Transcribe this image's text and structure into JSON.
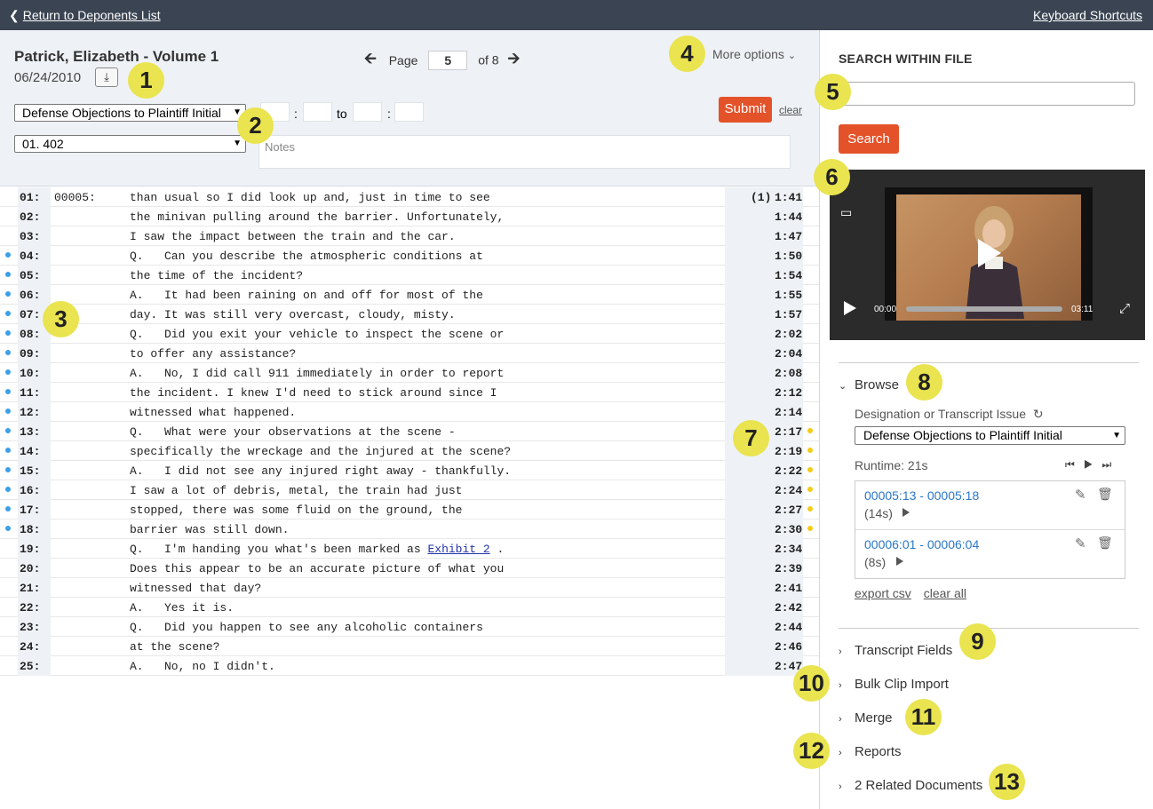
{
  "topbar": {
    "back_label": "Return to Deponents List",
    "shortcuts_label": "Keyboard Shortcuts"
  },
  "header": {
    "title": "Patrick, Elizabeth - Volume 1",
    "date": "06/24/2010",
    "page_label": "Page",
    "page_value": "5",
    "page_of": "of 8",
    "more_options": "More options",
    "designation_select": "Defense Objections to Plaintiff Initial",
    "issue_select": "01. 402",
    "to_label": "to",
    "colon": ":",
    "submit_label": "Submit",
    "clear_label": "clear",
    "notes_placeholder": "Notes"
  },
  "transcript": {
    "lines": [
      {
        "ln": "01:",
        "page": "00005:",
        "text": "than usual so I did look up and, just in time to see",
        "mark": "(1)",
        "ts": "1:41",
        "blue": false,
        "yellow": false
      },
      {
        "ln": "02:",
        "page": "",
        "text": "the minivan pulling around the barrier. Unfortunately,",
        "mark": "",
        "ts": "1:44",
        "blue": false,
        "yellow": false
      },
      {
        "ln": "03:",
        "page": "",
        "text": "I saw the impact between the train and the car.",
        "mark": "",
        "ts": "1:47",
        "blue": false,
        "yellow": false
      },
      {
        "ln": "04:",
        "page": "",
        "text": "Q.   Can you describe the atmospheric conditions at",
        "mark": "",
        "ts": "1:50",
        "blue": true,
        "yellow": false
      },
      {
        "ln": "05:",
        "page": "",
        "text": "the time of the incident?",
        "mark": "",
        "ts": "1:54",
        "blue": true,
        "yellow": false
      },
      {
        "ln": "06:",
        "page": "",
        "text": "A.   It had been raining on and off for most of the",
        "mark": "",
        "ts": "1:55",
        "blue": true,
        "yellow": false
      },
      {
        "ln": "07:",
        "page": "",
        "text": "day. It was still very overcast, cloudy, misty.",
        "mark": "",
        "ts": "1:57",
        "blue": true,
        "yellow": false
      },
      {
        "ln": "08:",
        "page": "",
        "text": "Q.   Did you exit your vehicle to inspect the scene or",
        "mark": "",
        "ts": "2:02",
        "blue": true,
        "yellow": false
      },
      {
        "ln": "09:",
        "page": "",
        "text": "to offer any assistance?",
        "mark": "",
        "ts": "2:04",
        "blue": true,
        "yellow": false
      },
      {
        "ln": "10:",
        "page": "",
        "text": "A.   No, I did call 911 immediately in order to report",
        "mark": "",
        "ts": "2:08",
        "blue": true,
        "yellow": false
      },
      {
        "ln": "11:",
        "page": "",
        "text": "the incident. I knew I'd need to stick around since I",
        "mark": "",
        "ts": "2:12",
        "blue": true,
        "yellow": false
      },
      {
        "ln": "12:",
        "page": "",
        "text": "witnessed what happened.",
        "mark": "",
        "ts": "2:14",
        "blue": true,
        "yellow": false
      },
      {
        "ln": "13:",
        "page": "",
        "text": "Q.   What were your observations at the scene -",
        "mark": "",
        "ts": "2:17",
        "blue": true,
        "yellow": true
      },
      {
        "ln": "14:",
        "page": "",
        "text": "specifically the wreckage and the injured at the scene?",
        "mark": "",
        "ts": "2:19",
        "blue": true,
        "yellow": true
      },
      {
        "ln": "15:",
        "page": "",
        "text": "A.   I did not see any injured right away - thankfully.",
        "mark": "",
        "ts": "2:22",
        "blue": true,
        "yellow": true
      },
      {
        "ln": "16:",
        "page": "",
        "text": "I saw a lot of debris, metal, the train had just",
        "mark": "",
        "ts": "2:24",
        "blue": true,
        "yellow": true
      },
      {
        "ln": "17:",
        "page": "",
        "text": "stopped, there was some fluid on the ground, the",
        "mark": "",
        "ts": "2:27",
        "blue": true,
        "yellow": true
      },
      {
        "ln": "18:",
        "page": "",
        "text": "barrier was still down.",
        "mark": "",
        "ts": "2:30",
        "blue": true,
        "yellow": true
      },
      {
        "ln": "19:",
        "page": "",
        "text": "Q.   I'm handing you what's been marked as ",
        "link": "Exhibit 2",
        "after": " .",
        "mark": "",
        "ts": "2:34",
        "blue": false,
        "yellow": false
      },
      {
        "ln": "20:",
        "page": "",
        "text": "Does this appear to be an accurate picture of what you",
        "mark": "",
        "ts": "2:39",
        "blue": false,
        "yellow": false
      },
      {
        "ln": "21:",
        "page": "",
        "text": "witnessed that day?",
        "mark": "",
        "ts": "2:41",
        "blue": false,
        "yellow": false
      },
      {
        "ln": "22:",
        "page": "",
        "text": "A.   Yes it is.",
        "mark": "",
        "ts": "2:42",
        "blue": false,
        "yellow": false
      },
      {
        "ln": "23:",
        "page": "",
        "text": "Q.   Did you happen to see any alcoholic containers",
        "mark": "",
        "ts": "2:44",
        "blue": false,
        "yellow": false
      },
      {
        "ln": "24:",
        "page": "",
        "text": "at the scene?",
        "mark": "",
        "ts": "2:46",
        "blue": false,
        "yellow": false
      },
      {
        "ln": "25:",
        "page": "",
        "text": "A.   No, no I didn't.",
        "mark": "",
        "ts": "2:47",
        "blue": false,
        "yellow": false
      }
    ]
  },
  "sidebar": {
    "search_heading": "SEARCH WITHIN FILE",
    "search_button": "Search",
    "video": {
      "current_time": "00:00",
      "duration": "03:11",
      "progress": 0
    },
    "browse": {
      "label": "Browse",
      "designation_label": "Designation or Transcript Issue",
      "designation_value": "Defense Objections to Plaintiff Initial",
      "runtime": "Runtime: 21s",
      "clips": [
        {
          "range": "00005:13 - 00005:18",
          "duration": "(14s)"
        },
        {
          "range": "00006:01 - 00006:04",
          "duration": "(8s)"
        }
      ],
      "export_label": "export csv",
      "clear_all_label": "clear all"
    },
    "sections": {
      "transcript_fields": "Transcript Fields",
      "bulk_clip_import": "Bulk Clip Import",
      "merge": "Merge",
      "reports": "Reports",
      "related_documents": "2 Related Documents"
    }
  },
  "callouts": [
    "1",
    "2",
    "3",
    "4",
    "5",
    "6",
    "7",
    "8",
    "9",
    "10",
    "11",
    "12",
    "13"
  ],
  "colors": {
    "accent": "#e4522a",
    "topbar": "#3a4452",
    "callout": "#e9e44f",
    "link": "#2a77c9",
    "blue_dot": "#3aa0e8",
    "yellow_dot": "#f5cc15"
  }
}
